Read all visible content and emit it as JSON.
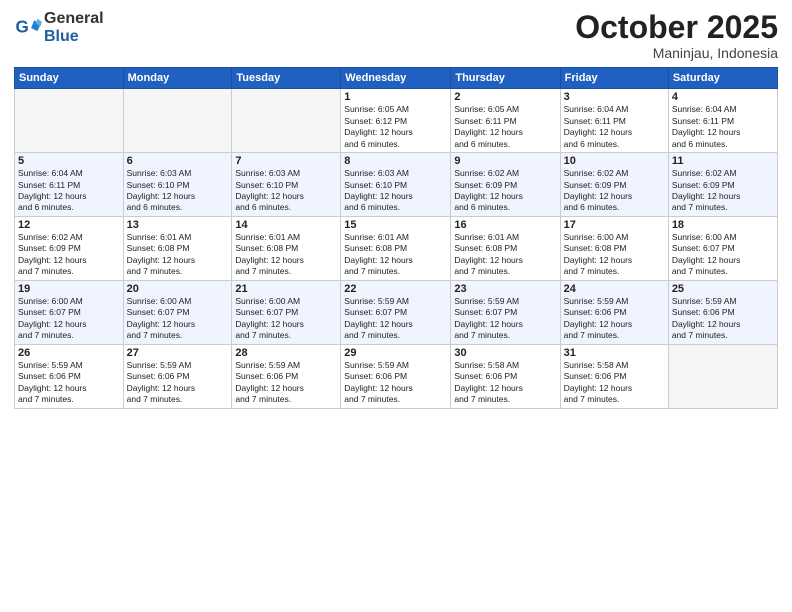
{
  "header": {
    "logo_general": "General",
    "logo_blue": "Blue",
    "month": "October 2025",
    "location": "Maninjau, Indonesia"
  },
  "weekdays": [
    "Sunday",
    "Monday",
    "Tuesday",
    "Wednesday",
    "Thursday",
    "Friday",
    "Saturday"
  ],
  "weeks": [
    [
      {
        "day": "",
        "info": ""
      },
      {
        "day": "",
        "info": ""
      },
      {
        "day": "",
        "info": ""
      },
      {
        "day": "1",
        "info": "Sunrise: 6:05 AM\nSunset: 6:12 PM\nDaylight: 12 hours\nand 6 minutes."
      },
      {
        "day": "2",
        "info": "Sunrise: 6:05 AM\nSunset: 6:11 PM\nDaylight: 12 hours\nand 6 minutes."
      },
      {
        "day": "3",
        "info": "Sunrise: 6:04 AM\nSunset: 6:11 PM\nDaylight: 12 hours\nand 6 minutes."
      },
      {
        "day": "4",
        "info": "Sunrise: 6:04 AM\nSunset: 6:11 PM\nDaylight: 12 hours\nand 6 minutes."
      }
    ],
    [
      {
        "day": "5",
        "info": "Sunrise: 6:04 AM\nSunset: 6:11 PM\nDaylight: 12 hours\nand 6 minutes."
      },
      {
        "day": "6",
        "info": "Sunrise: 6:03 AM\nSunset: 6:10 PM\nDaylight: 12 hours\nand 6 minutes."
      },
      {
        "day": "7",
        "info": "Sunrise: 6:03 AM\nSunset: 6:10 PM\nDaylight: 12 hours\nand 6 minutes."
      },
      {
        "day": "8",
        "info": "Sunrise: 6:03 AM\nSunset: 6:10 PM\nDaylight: 12 hours\nand 6 minutes."
      },
      {
        "day": "9",
        "info": "Sunrise: 6:02 AM\nSunset: 6:09 PM\nDaylight: 12 hours\nand 6 minutes."
      },
      {
        "day": "10",
        "info": "Sunrise: 6:02 AM\nSunset: 6:09 PM\nDaylight: 12 hours\nand 6 minutes."
      },
      {
        "day": "11",
        "info": "Sunrise: 6:02 AM\nSunset: 6:09 PM\nDaylight: 12 hours\nand 7 minutes."
      }
    ],
    [
      {
        "day": "12",
        "info": "Sunrise: 6:02 AM\nSunset: 6:09 PM\nDaylight: 12 hours\nand 7 minutes."
      },
      {
        "day": "13",
        "info": "Sunrise: 6:01 AM\nSunset: 6:08 PM\nDaylight: 12 hours\nand 7 minutes."
      },
      {
        "day": "14",
        "info": "Sunrise: 6:01 AM\nSunset: 6:08 PM\nDaylight: 12 hours\nand 7 minutes."
      },
      {
        "day": "15",
        "info": "Sunrise: 6:01 AM\nSunset: 6:08 PM\nDaylight: 12 hours\nand 7 minutes."
      },
      {
        "day": "16",
        "info": "Sunrise: 6:01 AM\nSunset: 6:08 PM\nDaylight: 12 hours\nand 7 minutes."
      },
      {
        "day": "17",
        "info": "Sunrise: 6:00 AM\nSunset: 6:08 PM\nDaylight: 12 hours\nand 7 minutes."
      },
      {
        "day": "18",
        "info": "Sunrise: 6:00 AM\nSunset: 6:07 PM\nDaylight: 12 hours\nand 7 minutes."
      }
    ],
    [
      {
        "day": "19",
        "info": "Sunrise: 6:00 AM\nSunset: 6:07 PM\nDaylight: 12 hours\nand 7 minutes."
      },
      {
        "day": "20",
        "info": "Sunrise: 6:00 AM\nSunset: 6:07 PM\nDaylight: 12 hours\nand 7 minutes."
      },
      {
        "day": "21",
        "info": "Sunrise: 6:00 AM\nSunset: 6:07 PM\nDaylight: 12 hours\nand 7 minutes."
      },
      {
        "day": "22",
        "info": "Sunrise: 5:59 AM\nSunset: 6:07 PM\nDaylight: 12 hours\nand 7 minutes."
      },
      {
        "day": "23",
        "info": "Sunrise: 5:59 AM\nSunset: 6:07 PM\nDaylight: 12 hours\nand 7 minutes."
      },
      {
        "day": "24",
        "info": "Sunrise: 5:59 AM\nSunset: 6:06 PM\nDaylight: 12 hours\nand 7 minutes."
      },
      {
        "day": "25",
        "info": "Sunrise: 5:59 AM\nSunset: 6:06 PM\nDaylight: 12 hours\nand 7 minutes."
      }
    ],
    [
      {
        "day": "26",
        "info": "Sunrise: 5:59 AM\nSunset: 6:06 PM\nDaylight: 12 hours\nand 7 minutes."
      },
      {
        "day": "27",
        "info": "Sunrise: 5:59 AM\nSunset: 6:06 PM\nDaylight: 12 hours\nand 7 minutes."
      },
      {
        "day": "28",
        "info": "Sunrise: 5:59 AM\nSunset: 6:06 PM\nDaylight: 12 hours\nand 7 minutes."
      },
      {
        "day": "29",
        "info": "Sunrise: 5:59 AM\nSunset: 6:06 PM\nDaylight: 12 hours\nand 7 minutes."
      },
      {
        "day": "30",
        "info": "Sunrise: 5:58 AM\nSunset: 6:06 PM\nDaylight: 12 hours\nand 7 minutes."
      },
      {
        "day": "31",
        "info": "Sunrise: 5:58 AM\nSunset: 6:06 PM\nDaylight: 12 hours\nand 7 minutes."
      },
      {
        "day": "",
        "info": ""
      }
    ]
  ]
}
